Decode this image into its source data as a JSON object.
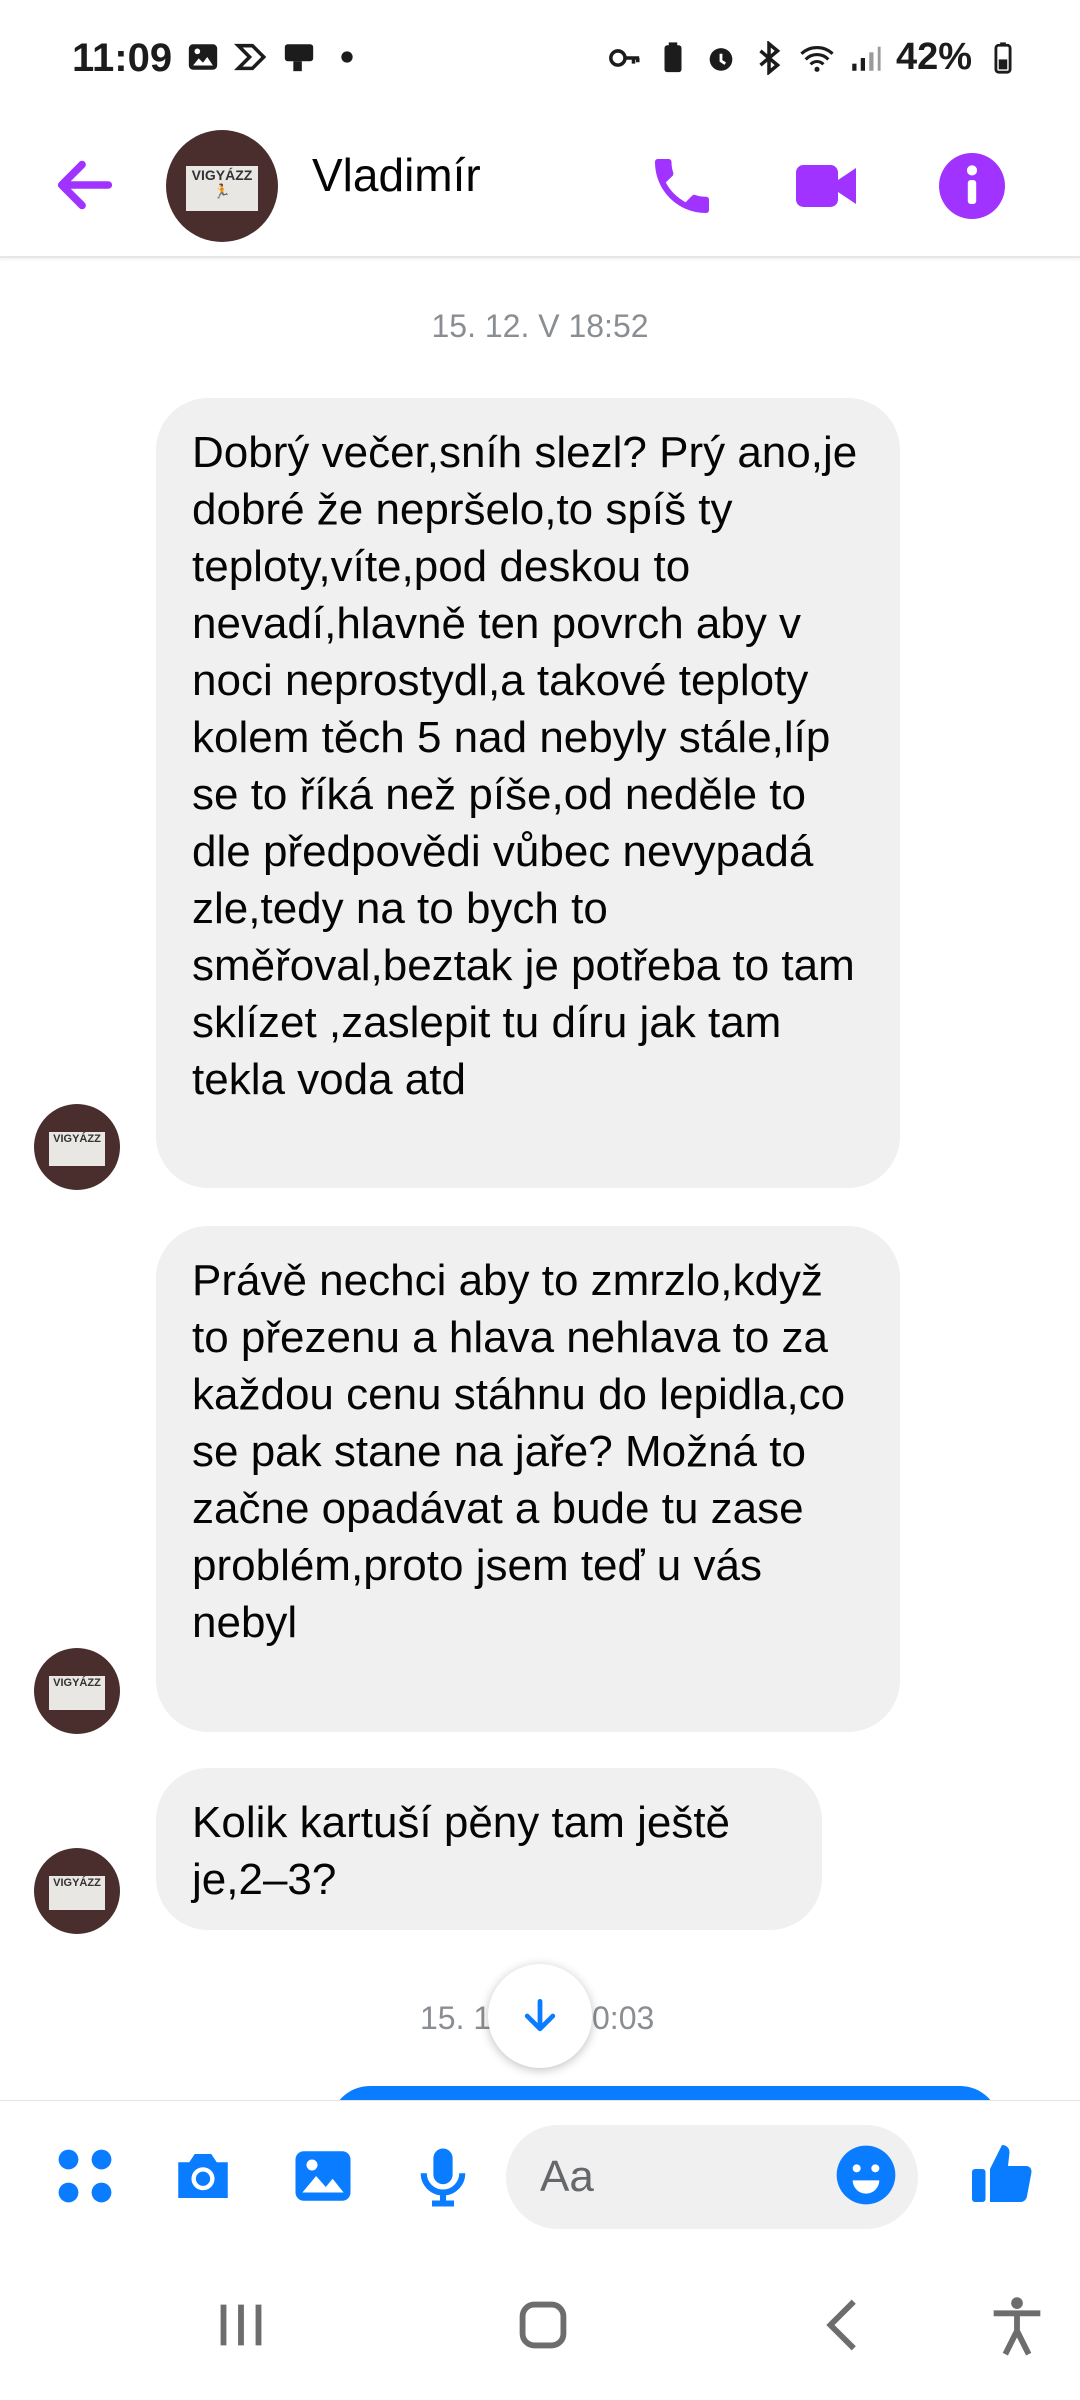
{
  "status_bar": {
    "time": "11:09",
    "battery": "42%"
  },
  "header": {
    "contact_name": "Vladimír",
    "avatar_sign_text": "VIGYÁZZ"
  },
  "messages": {
    "date_1": "15. 12. V 18:52",
    "bubble_1": "Dobrý večer,sníh slezl? Prý ano,je dobré že nepršelo,to spíš ty teploty,víte,pod deskou to nevadí,hlavně ten povrch aby v noci neprostydl,a takové teploty kolem těch 5 nad nebyly stále,líp se to říká než píše,od neděle to dle předpovědi vůbec nevypadá zle,tedy na to bych to směřoval,beztak je potřeba to tam sklízet ,zaslepit tu díru jak tam tekla voda atd",
    "bubble_2": "Právě nechci aby to zmrzlo,když to přezenu a hlava nehlava to za každou cenu stáhnu do lepidla,co se pak stane na jaře? Možná to začne opadávat a bude tu zase problém,proto jsem teď u vás nebyl",
    "bubble_3": "Kolik kartuší pěny tam ještě je,2–3?",
    "date_2_left": "15. 1",
    "date_2_right": "0:03"
  },
  "composer": {
    "placeholder": "Aa"
  },
  "colors": {
    "accent_purple": "#a033ff",
    "messenger_blue": "#0a7cff",
    "bubble_gray": "#f0f0f0"
  }
}
